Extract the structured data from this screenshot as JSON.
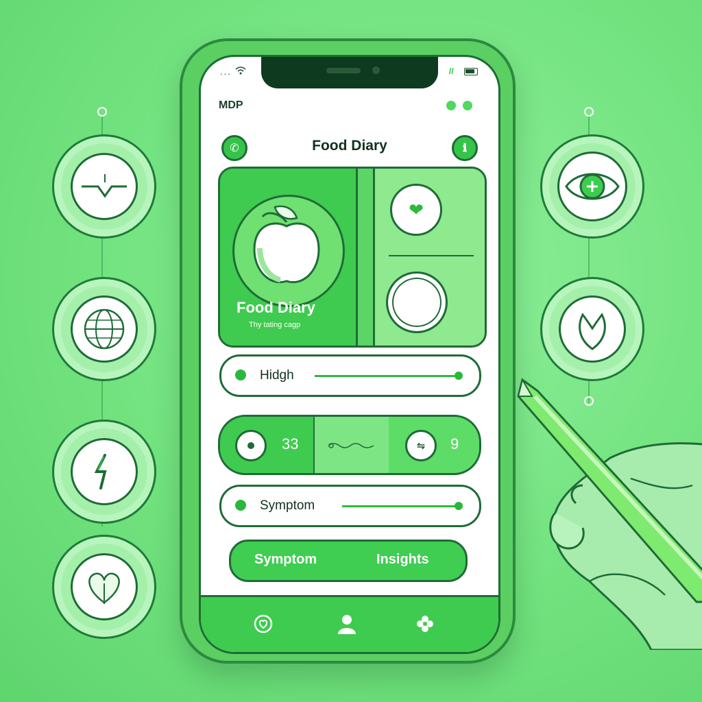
{
  "status_bar": {
    "signal": "...",
    "wifi": "wifi",
    "right": "//"
  },
  "app": {
    "brand": "MDP",
    "title": "Food Diary"
  },
  "hero": {
    "title": "Food Diary",
    "subtitle": "Thy tating cagp"
  },
  "sliders": [
    {
      "label": "Hidgh"
    },
    {
      "label": "Symptom"
    }
  ],
  "stats": [
    {
      "value": "33"
    },
    {
      "value": "9"
    }
  ],
  "actions": {
    "left": "Symptom",
    "right": "Insights"
  },
  "icons": {
    "left_side": [
      "heartbeat-icon",
      "globe-icon",
      "lightning-icon",
      "heart-leaf-icon"
    ],
    "right_side": [
      "eye-plus-icon",
      "leaf-icon"
    ],
    "header_left": "phone-icon",
    "header_right": "info-icon",
    "tabs": [
      "heart-shield-icon",
      "profile-icon",
      "flower-icon"
    ]
  },
  "colors": {
    "background": "#72e27f",
    "accent": "#3fcb4f",
    "dark": "#1f6b37"
  }
}
